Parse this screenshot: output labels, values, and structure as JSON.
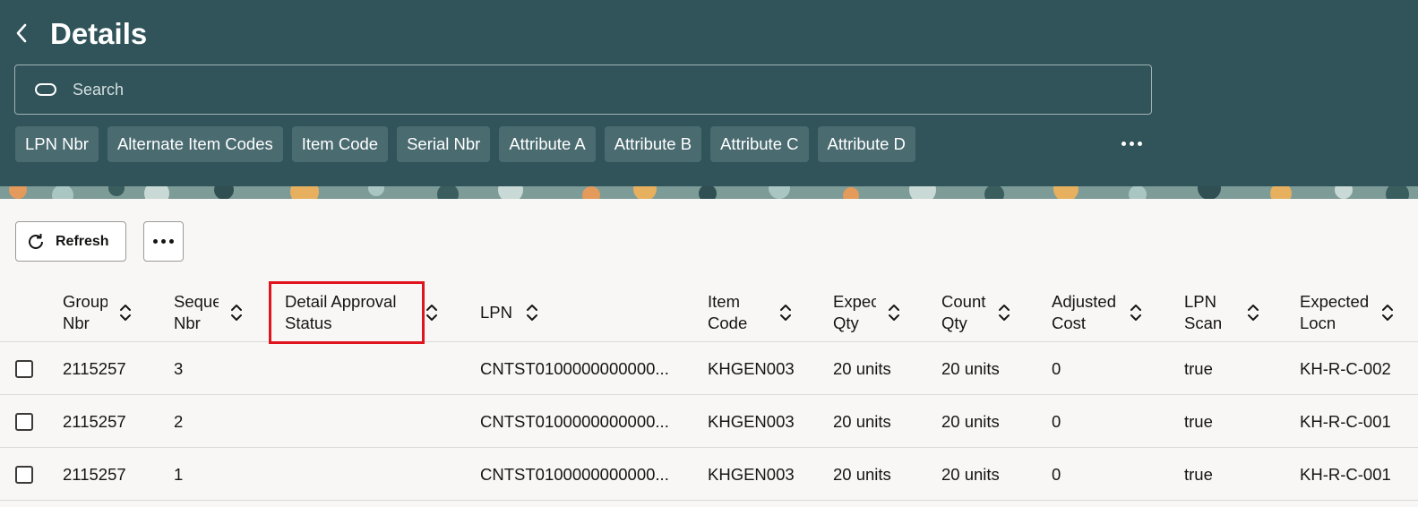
{
  "header": {
    "title": "Details",
    "back_icon": "chevron-left-icon",
    "search": {
      "placeholder": "Search",
      "value": ""
    },
    "chips": [
      "LPN Nbr",
      "Alternate Item Codes",
      "Item Code",
      "Serial Nbr",
      "Attribute A",
      "Attribute B",
      "Attribute C",
      "Attribute D"
    ],
    "accent_color": "#30545a"
  },
  "toolbar": {
    "refresh_label": "Refresh"
  },
  "table": {
    "columns": [
      {
        "key": "group_nbr",
        "label": "Group Nbr"
      },
      {
        "key": "sequence_nbr",
        "label": "Sequence Nbr"
      },
      {
        "key": "detail_approval_status",
        "label": "Detail Approval Status"
      },
      {
        "key": "lpn",
        "label": "LPN"
      },
      {
        "key": "item_code",
        "label": "Item Code"
      },
      {
        "key": "expected_qty",
        "label": "Expected Qty"
      },
      {
        "key": "count_qty",
        "label": "Count Qty"
      },
      {
        "key": "adjusted_cost",
        "label": "Adjusted Cost"
      },
      {
        "key": "lpn_scan",
        "label": "LPN Scan"
      },
      {
        "key": "expected_locn",
        "label": "Expected Locn"
      }
    ],
    "rows": [
      {
        "group_nbr": "2115257",
        "sequence_nbr": "3",
        "detail_approval_status": "",
        "lpn": "CNTST0100000000000...",
        "item_code": "KHGEN003",
        "expected_qty": "20 units",
        "count_qty": "20 units",
        "adjusted_cost": "0",
        "lpn_scan": "true",
        "expected_locn": "KH-R-C-002"
      },
      {
        "group_nbr": "2115257",
        "sequence_nbr": "2",
        "detail_approval_status": "",
        "lpn": "CNTST0100000000000...",
        "item_code": "KHGEN003",
        "expected_qty": "20 units",
        "count_qty": "20 units",
        "adjusted_cost": "0",
        "lpn_scan": "true",
        "expected_locn": "KH-R-C-001"
      },
      {
        "group_nbr": "2115257",
        "sequence_nbr": "1",
        "detail_approval_status": "",
        "lpn": "CNTST0100000000000...",
        "item_code": "KHGEN003",
        "expected_qty": "20 units",
        "count_qty": "20 units",
        "adjusted_cost": "0",
        "lpn_scan": "true",
        "expected_locn": "KH-R-C-001"
      }
    ],
    "highlight_color": "#e0141e"
  }
}
